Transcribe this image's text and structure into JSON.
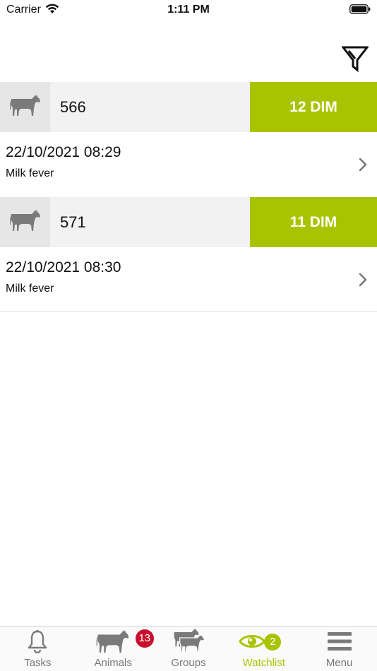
{
  "status_bar": {
    "carrier": "Carrier",
    "time": "1:11 PM"
  },
  "nav_bar": {
    "filter_icon": "filter-icon"
  },
  "watchlist": [
    {
      "animal_number": "566",
      "dim": "12 DIM",
      "event_datetime": "22/10/2021 08:29",
      "event_type": "Milk fever"
    },
    {
      "animal_number": "571",
      "dim": "11 DIM",
      "event_datetime": "22/10/2021 08:30",
      "event_type": "Milk fever"
    }
  ],
  "tab_bar": {
    "tabs": [
      {
        "label": "Tasks",
        "icon": "bell-icon"
      },
      {
        "label": "Animals",
        "icon": "cow-icon",
        "badge": "13"
      },
      {
        "label": "Groups",
        "icon": "cow-group-icon"
      },
      {
        "label": "Watchlist",
        "icon": "eye-icon",
        "badge": "2",
        "active": true
      },
      {
        "label": "Menu",
        "icon": "hamburger-icon"
      }
    ]
  },
  "colors": {
    "accent": "#a8c400",
    "badge_red": "#c8102e",
    "row_header_bg": "#f2f2f2",
    "icon_gray": "#7a7a7a"
  }
}
